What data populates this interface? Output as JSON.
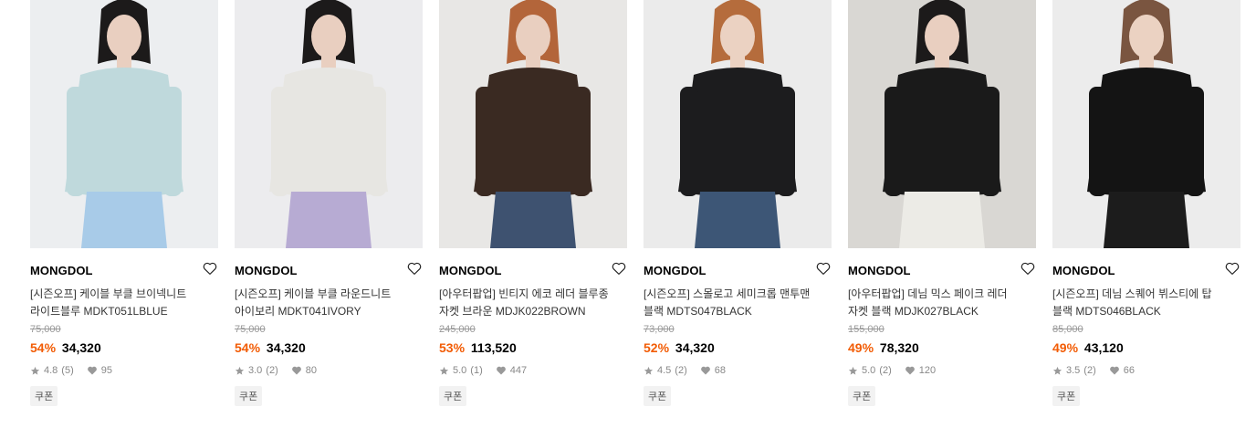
{
  "products": [
    {
      "brand": "MONGDOL",
      "title_line1": "[시즌오프] 케이블 부클 브이넥니트",
      "title_line2": "라이트블루 MDKT051LBLUE",
      "original_price": "75,000",
      "discount": "54%",
      "price": "34,320",
      "rating": "4.8",
      "review_count": "(5)",
      "likes": "95",
      "coupon": "쿠폰",
      "colors": {
        "bg": "#eceef0",
        "top": "#bfd9dc",
        "bottom": "#a8cbe8",
        "hair": "#1c1a1a",
        "skin": "#e9cfc0"
      }
    },
    {
      "brand": "MONGDOL",
      "title_line1": "[시즌오프] 케이블 부클 라운드니트",
      "title_line2": "아이보리 MDKT041IVORY",
      "original_price": "75,000",
      "discount": "54%",
      "price": "34,320",
      "rating": "3.0",
      "review_count": "(2)",
      "likes": "80",
      "coupon": "쿠폰",
      "colors": {
        "bg": "#ececee",
        "top": "#e7e6e2",
        "bottom": "#b7abd3",
        "hair": "#1c1a1a",
        "skin": "#e9cfc0"
      }
    },
    {
      "brand": "MONGDOL",
      "title_line1": "[아우터팝업] 빈티지 에코 레더 블루종",
      "title_line2": "자켓 브라운 MDJK022BROWN",
      "original_price": "245,000",
      "discount": "53%",
      "price": "113,520",
      "rating": "5.0",
      "review_count": "(1)",
      "likes": "447",
      "coupon": "쿠폰",
      "colors": {
        "bg": "#e8e7e5",
        "top": "#3a2a22",
        "bottom": "#3e5270",
        "hair": "#b3653a",
        "skin": "#e9cfc0"
      }
    },
    {
      "brand": "MONGDOL",
      "title_line1": "[시즌오프] 스몰로고 세미크롭 맨투맨",
      "title_line2": "블랙 MDTS047BLACK",
      "original_price": "73,000",
      "discount": "52%",
      "price": "34,320",
      "rating": "4.5",
      "review_count": "(2)",
      "likes": "68",
      "coupon": "쿠폰",
      "colors": {
        "bg": "#ebebeb",
        "top": "#1c1c1e",
        "bottom": "#3d5676",
        "hair": "#b56c3c",
        "skin": "#ebd2c2"
      }
    },
    {
      "brand": "MONGDOL",
      "title_line1": "[아우터팝업] 데님 믹스 페이크 레더",
      "title_line2": "자켓 블랙 MDJK027BLACK",
      "original_price": "155,000",
      "discount": "49%",
      "price": "78,320",
      "rating": "5.0",
      "review_count": "(2)",
      "likes": "120",
      "coupon": "쿠폰",
      "colors": {
        "bg": "#d9d7d3",
        "top": "#1a1a1a",
        "bottom": "#ecebe6",
        "hair": "#1c1a1a",
        "skin": "#e9cfc0"
      }
    },
    {
      "brand": "MONGDOL",
      "title_line1": "[시즌오프] 데님 스퀘어 뷔스티에 탑",
      "title_line2": "블랙 MDTS046BLACK",
      "original_price": "85,000",
      "discount": "49%",
      "price": "43,120",
      "rating": "3.5",
      "review_count": "(2)",
      "likes": "66",
      "coupon": "쿠폰",
      "colors": {
        "bg": "#ececec",
        "top": "#141414",
        "bottom": "#1c1c1c",
        "hair": "#7a5540",
        "skin": "#ebd2c2"
      }
    }
  ]
}
